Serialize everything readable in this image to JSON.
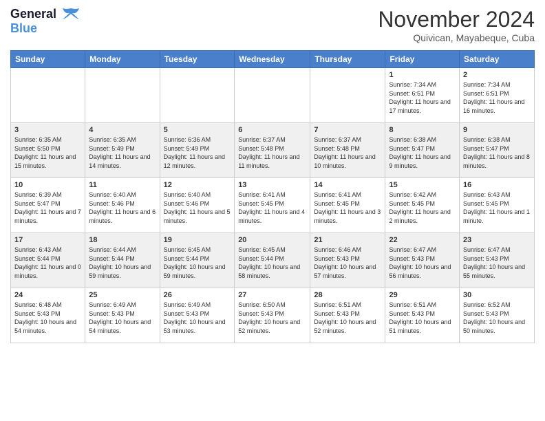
{
  "header": {
    "logo_line1": "General",
    "logo_line2": "Blue",
    "month_title": "November 2024",
    "location": "Quivican, Mayabeque, Cuba"
  },
  "weekdays": [
    "Sunday",
    "Monday",
    "Tuesday",
    "Wednesday",
    "Thursday",
    "Friday",
    "Saturday"
  ],
  "weeks": [
    [
      {
        "day": "",
        "info": ""
      },
      {
        "day": "",
        "info": ""
      },
      {
        "day": "",
        "info": ""
      },
      {
        "day": "",
        "info": ""
      },
      {
        "day": "",
        "info": ""
      },
      {
        "day": "1",
        "info": "Sunrise: 7:34 AM\nSunset: 6:51 PM\nDaylight: 11 hours and 17 minutes."
      },
      {
        "day": "2",
        "info": "Sunrise: 7:34 AM\nSunset: 6:51 PM\nDaylight: 11 hours and 16 minutes."
      }
    ],
    [
      {
        "day": "3",
        "info": "Sunrise: 6:35 AM\nSunset: 5:50 PM\nDaylight: 11 hours and 15 minutes."
      },
      {
        "day": "4",
        "info": "Sunrise: 6:35 AM\nSunset: 5:49 PM\nDaylight: 11 hours and 14 minutes."
      },
      {
        "day": "5",
        "info": "Sunrise: 6:36 AM\nSunset: 5:49 PM\nDaylight: 11 hours and 12 minutes."
      },
      {
        "day": "6",
        "info": "Sunrise: 6:37 AM\nSunset: 5:48 PM\nDaylight: 11 hours and 11 minutes."
      },
      {
        "day": "7",
        "info": "Sunrise: 6:37 AM\nSunset: 5:48 PM\nDaylight: 11 hours and 10 minutes."
      },
      {
        "day": "8",
        "info": "Sunrise: 6:38 AM\nSunset: 5:47 PM\nDaylight: 11 hours and 9 minutes."
      },
      {
        "day": "9",
        "info": "Sunrise: 6:38 AM\nSunset: 5:47 PM\nDaylight: 11 hours and 8 minutes."
      }
    ],
    [
      {
        "day": "10",
        "info": "Sunrise: 6:39 AM\nSunset: 5:47 PM\nDaylight: 11 hours and 7 minutes."
      },
      {
        "day": "11",
        "info": "Sunrise: 6:40 AM\nSunset: 5:46 PM\nDaylight: 11 hours and 6 minutes."
      },
      {
        "day": "12",
        "info": "Sunrise: 6:40 AM\nSunset: 5:46 PM\nDaylight: 11 hours and 5 minutes."
      },
      {
        "day": "13",
        "info": "Sunrise: 6:41 AM\nSunset: 5:45 PM\nDaylight: 11 hours and 4 minutes."
      },
      {
        "day": "14",
        "info": "Sunrise: 6:41 AM\nSunset: 5:45 PM\nDaylight: 11 hours and 3 minutes."
      },
      {
        "day": "15",
        "info": "Sunrise: 6:42 AM\nSunset: 5:45 PM\nDaylight: 11 hours and 2 minutes."
      },
      {
        "day": "16",
        "info": "Sunrise: 6:43 AM\nSunset: 5:45 PM\nDaylight: 11 hours and 1 minute."
      }
    ],
    [
      {
        "day": "17",
        "info": "Sunrise: 6:43 AM\nSunset: 5:44 PM\nDaylight: 11 hours and 0 minutes."
      },
      {
        "day": "18",
        "info": "Sunrise: 6:44 AM\nSunset: 5:44 PM\nDaylight: 10 hours and 59 minutes."
      },
      {
        "day": "19",
        "info": "Sunrise: 6:45 AM\nSunset: 5:44 PM\nDaylight: 10 hours and 59 minutes."
      },
      {
        "day": "20",
        "info": "Sunrise: 6:45 AM\nSunset: 5:44 PM\nDaylight: 10 hours and 58 minutes."
      },
      {
        "day": "21",
        "info": "Sunrise: 6:46 AM\nSunset: 5:43 PM\nDaylight: 10 hours and 57 minutes."
      },
      {
        "day": "22",
        "info": "Sunrise: 6:47 AM\nSunset: 5:43 PM\nDaylight: 10 hours and 56 minutes."
      },
      {
        "day": "23",
        "info": "Sunrise: 6:47 AM\nSunset: 5:43 PM\nDaylight: 10 hours and 55 minutes."
      }
    ],
    [
      {
        "day": "24",
        "info": "Sunrise: 6:48 AM\nSunset: 5:43 PM\nDaylight: 10 hours and 54 minutes."
      },
      {
        "day": "25",
        "info": "Sunrise: 6:49 AM\nSunset: 5:43 PM\nDaylight: 10 hours and 54 minutes."
      },
      {
        "day": "26",
        "info": "Sunrise: 6:49 AM\nSunset: 5:43 PM\nDaylight: 10 hours and 53 minutes."
      },
      {
        "day": "27",
        "info": "Sunrise: 6:50 AM\nSunset: 5:43 PM\nDaylight: 10 hours and 52 minutes."
      },
      {
        "day": "28",
        "info": "Sunrise: 6:51 AM\nSunset: 5:43 PM\nDaylight: 10 hours and 52 minutes."
      },
      {
        "day": "29",
        "info": "Sunrise: 6:51 AM\nSunset: 5:43 PM\nDaylight: 10 hours and 51 minutes."
      },
      {
        "day": "30",
        "info": "Sunrise: 6:52 AM\nSunset: 5:43 PM\nDaylight: 10 hours and 50 minutes."
      }
    ]
  ]
}
